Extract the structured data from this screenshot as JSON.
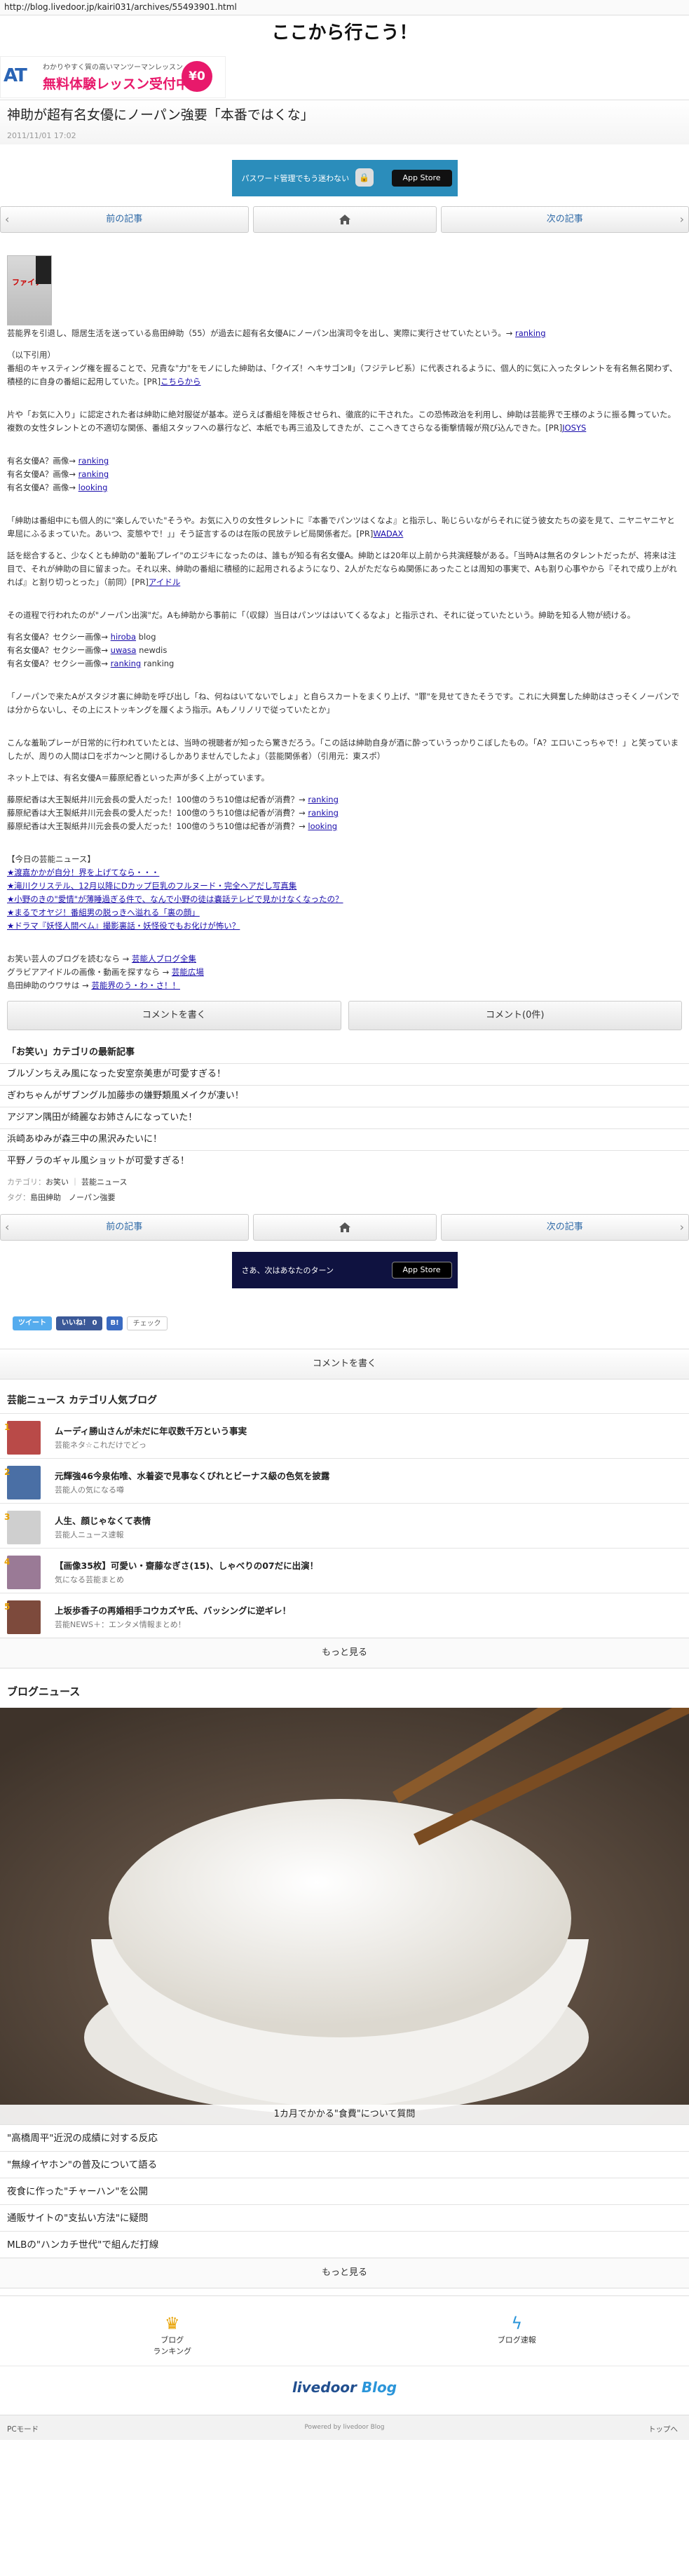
{
  "url": "http://blog.livedoor.jp/kairi031/archives/55493901.html",
  "blog_title": "ここから行こう！",
  "top_banner": {
    "logo": "AT",
    "line1": "わかりやすく質の高いマンツーマンレッスン",
    "line2": "無料体験レッスン受付中！",
    "badge": "¥0"
  },
  "article": {
    "title": "神助が超有名女優にノーパン強要「本番ではくな」",
    "date": "2011/11/01 17:02"
  },
  "ad_mid": {
    "text": "パスワード管理でもう迷わない",
    "store": " App Store"
  },
  "pager": {
    "prev": "前の記事",
    "next": "次の記事",
    "home_icon": "home-icon"
  },
  "thumb_text": "ファイナ",
  "body": {
    "p1_pre": "芸能界を引退し、隠居生活を送っている島田紳助（55）が過去に超有名女優Aにノーパン出演司令を出し、実際に実行させていたという。→ ",
    "p1_link": "ranking",
    "p2_a": "（以下引用）",
    "p2_b": "番組のキャスティング権を握ることで、兄貴な\"力\"をモノにした紳助は、「クイズ！ヘキサゴンⅡ」（フジテレビ系）に代表されるように、個人的に気に入ったタレントを有名無名関わず、積極的に自身の番組に起用していた。[PR]",
    "p2_link": "こちらから",
    "p3": "片や「お気に入り」に認定された者は紳助に絶対服従が基本。逆らえば番組を降板させられ、徹底的に干された。この恐怖政治を利用し、紳助は芸能界で王様のように振る舞っていた。複数の女性タレントとの不適切な関係、番組スタッフへの暴行など、本紙でも再三追及してきたが、ここへきてさらなる衝撃情報が飛び込んできた。[PR]",
    "p3_link": "JOSYS",
    "list1": [
      {
        "pre": "有名女優A？画像→ ",
        "link": "ranking"
      },
      {
        "pre": "有名女優A？画像→ ",
        "link": "ranking"
      },
      {
        "pre": "有名女優A？画像→ ",
        "link": "looking"
      }
    ],
    "p4": "「紳助は番組中にも個人的に\"楽しんでいた\"そうや。お気に入りの女性タレントに『本番でパンツはくなよ』と指示し、恥じらいながらそれに従う彼女たちの姿を見て、ニヤニヤニヤと卑屈にふるまっていた。あいつ、変態やで！」」そう証言するのは在阪の民放テレビ局関係者だ。[PR]",
    "p4_link": "WADAX",
    "p5": "話を総合すると、少なくとも紳助の\"羞恥プレイ\"のエジキになったのは、誰もが知る有名女優A。紳助とは20年以上前から共演経験がある。「当時Aは無名のタレントだったが、将来は注目で、それが紳助の目に留まった。それ以来、紳助の番組に積極的に起用されるようになり、2人がただならぬ関係にあったことは周知の事実で、Aも割り心事やから『それで成り上がれれば』と割り切っとった」（前同）[PR]",
    "p5_link": "アイドル",
    "p6": "その道程で行われたのが\"ノーパン出演\"だ。Aも紳助から事前に「（収録）当日はパンツははいてくるなよ」と指示され、それに従っていたという。紳助を知る人物が続ける。",
    "list2": [
      {
        "pre": "有名女優A？セクシー画像→ ",
        "link": "hiroba",
        "post": " blog"
      },
      {
        "pre": "有名女優A？セクシー画像→ ",
        "link": "uwasa",
        "post": " newdis"
      },
      {
        "pre": "有名女優A？セクシー画像→ ",
        "link": "ranking",
        "post": " ranking"
      }
    ],
    "p7": "「ノーパンで来たAがスタジオ裏に紳助を呼び出し「ね、何ねはいてないでしょ」と自らスカートをまくり上げ、\"罪\"を見せてきたそうです。これに大興奮した紳助はさっそくノーパンでは分からないし、その上にストッキングを履くよう指示。Aもノリノリで従っていたとか」",
    "p8": "こんな羞恥プレーが日常的に行われていたとは、当時の視聴者が知ったら驚きだろう。「この話は紳助自身が酒に酔っていうっかりこぼしたもの。「A？エロいこっちゃで！」と笑っていましたが、周りの人間は口をポカ～ンと開けるしかありませんでしたよ」（芸能関係者）（引用元：東スポ）",
    "p9": "ネット上では、有名女優A＝藤原紀香といった声が多く上がっています。",
    "list3": [
      {
        "pre": "藤原紀香は大王製紙井川元会長の愛人だった！100億のうち10億は紀香が消費？→ ",
        "link": "ranking"
      },
      {
        "pre": "藤原紀香は大王製紙井川元会長の愛人だった！100億のうち10億は紀香が消費？→ ",
        "link": "ranking"
      },
      {
        "pre": "藤原紀香は大王製紙井川元会長の愛人だった！100億のうち10億は紀香が消費？→ ",
        "link": "looking"
      }
    ],
    "today_h": "【今日の芸能ニュース】",
    "today": [
      "★渡嘉かかが自分！界を上げてなら・・・",
      "★滝川クリステル、12月以降にDカップ巨乳のフルヌード・完全ヘアだし写真集",
      "★小野のきの\"愛情\"が薄睡過ぎる件で、なんで小野の徒は嚢話テレビで見かけなくなったの？",
      "★まるでオヤジ！番組男の脱っきへ溢れる「裏の顔」",
      "★ドラマ『妖怪人間ベム』撮影裏話・妖怪役でもお化けが怖い？"
    ],
    "cl1_pre": "お笑い芸人のブログを読むなら → ",
    "cl1_link": "芸能人ブログ全集",
    "cl2_pre": "グラビアアイドルの画像・動画を探すなら → ",
    "cl2_link": "芸能広場",
    "cl3_pre": "島田紳助のウワサは → ",
    "cl3_link": "芸能界のう・わ・さ！！"
  },
  "comment_buttons": {
    "write": "コメントを書く",
    "count": "コメント(0件)"
  },
  "category_h": "「お笑い」カテゴリの最新記事",
  "category_items": [
    "ブルゾンちえみ風になった安室奈美恵が可愛すぎる！",
    "ぎわちゃんがザブングル加藤歩の嫌野類風メイクが凄い！",
    "アジアン隅田が綺麗なお姉さんになっていた！",
    "浜崎あゆみが森三中の黒沢みたいに！",
    "平野ノラのギャル風ショットが可愛すぎる！"
  ],
  "tags": {
    "category_label": "カテゴリ：",
    "category_value": "お笑い",
    "sep": "｜",
    "category_value2": "芸能ニュース",
    "tag_label": "タグ：",
    "tags": [
      "島田紳助",
      "ノーパン強要"
    ]
  },
  "ad_bottom": {
    "text": "さあ、次はあなたのターン",
    "store": " App Store"
  },
  "share": {
    "tweet": "ツイート",
    "like": "いいね！ 0",
    "hatena": "B!",
    "mixi": "チェック"
  },
  "comment_write": "コメントを書く",
  "popular": {
    "heading": "芸能ニュース カテゴリ人気ブログ",
    "items": [
      {
        "num": "1",
        "title": "ムーディ勝山さんが未だに年収数千万という事実",
        "sub": "芸能ネタ☆これだけでどっ",
        "color": "#b94a48"
      },
      {
        "num": "2",
        "title": "元輝強46今泉佑唯、水着姿で見事なくびれとビーナス級の色気を披露",
        "sub": "芸能人の気になる噂",
        "color": "#4a6fa5"
      },
      {
        "num": "3",
        "title": "人生、顔じゃなくて表情",
        "sub": "芸能人ニュース速報",
        "color": "#cfcfcf"
      },
      {
        "num": "4",
        "title": "【画像35枚】可愛い・齋藤なぎさ(15)、しゃべりの07だに出演！",
        "sub": "気になる芸能まとめ",
        "color": "#9a7a96"
      },
      {
        "num": "5",
        "title": "上坂歩香子の再婚相手コウカズヤ氏、バッシングに逆ギレ！",
        "sub": "芸能NEWS＋：エンタメ情報まとめ！",
        "color": "#7d4a3c"
      }
    ],
    "more": "もっと見る"
  },
  "blog_news": {
    "heading": "ブログニュース",
    "hero_caption": "1カ月でかかる\"食費\"について質問",
    "items": [
      "\"高橋周平\"近況の成績に対する反応",
      "\"無線イヤホン\"の普及について語る",
      "夜食に作った\"チャーハン\"を公開",
      "通販サイトの\"支払い方法\"に疑問",
      "MLBの\"ハンカチ世代\"で組んだ打線"
    ],
    "more": "もっと見る"
  },
  "footer_nav": {
    "ranking": "ブログ\nランキング",
    "speed": "ブログ速報"
  },
  "livedoor": {
    "a": "livedoor",
    "b": "Blog"
  },
  "bottom": {
    "pc": "PCモード",
    "powered": "Powered by livedoor Blog",
    "top": "トップへ"
  }
}
